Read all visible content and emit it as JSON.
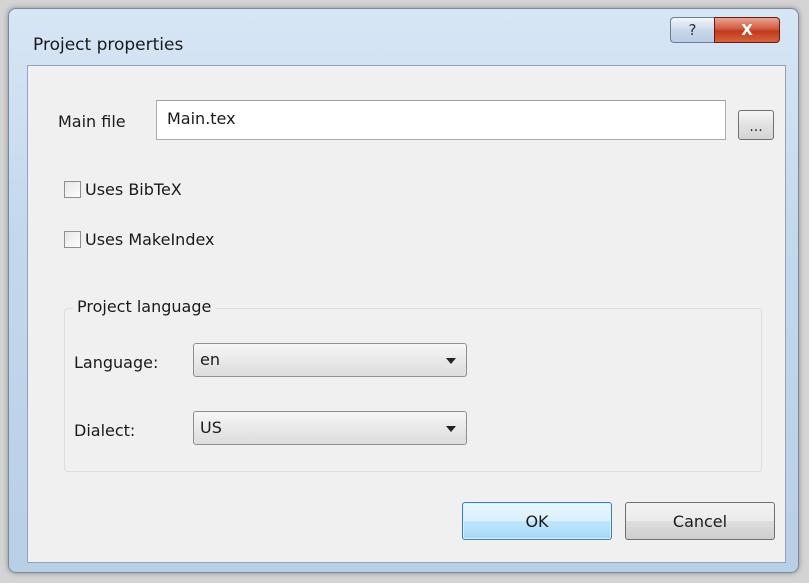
{
  "window": {
    "title": "Project properties",
    "help_glyph": "?",
    "close_glyph": "X"
  },
  "main_file": {
    "label": "Main file",
    "value": "Main.tex",
    "browse_label": "..."
  },
  "options": {
    "uses_bibtex": {
      "label": "Uses BibTeX",
      "checked": false
    },
    "uses_makeindex": {
      "label": "Uses MakeIndex",
      "checked": false
    }
  },
  "language_group": {
    "title": "Project language",
    "language_label": "Language:",
    "language_value": "en",
    "dialect_label": "Dialect:",
    "dialect_value": "US"
  },
  "buttons": {
    "ok_label": "OK",
    "cancel_label": "Cancel"
  },
  "colors": {
    "close_button": "#c13a1d",
    "default_button_border": "#3c7fb1",
    "client_background": "#f0f0f0"
  },
  "icons": {
    "help": "question-icon",
    "close": "close-icon",
    "dropdown": "chevron-down-icon"
  }
}
